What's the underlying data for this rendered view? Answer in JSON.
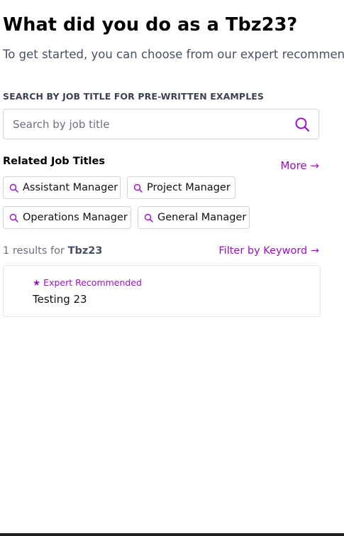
{
  "header": {
    "title": "What did you do as a Tbz23?",
    "subtitle": "To get started, you can choose from our expert recommende"
  },
  "search": {
    "label": "SEARCH BY JOB TITLE FOR PRE-WRITTEN EXAMPLES",
    "placeholder": "Search by job title",
    "value": "",
    "icon": "search-icon"
  },
  "related": {
    "title": "Related Job Titles",
    "more_label": "More →",
    "items": [
      {
        "label": "Assistant Manager",
        "icon": "search-icon"
      },
      {
        "label": "Project Manager",
        "icon": "search-icon"
      },
      {
        "label": "Operations Manager",
        "icon": "search-icon"
      },
      {
        "label": "General Manager",
        "icon": "search-icon"
      }
    ]
  },
  "results": {
    "count_prefix": "1 results for ",
    "query": "Tbz23",
    "filter_label": "Filter by Keyword →",
    "items": [
      {
        "badge": "★ Expert Recommended",
        "title": "Testing 23"
      }
    ]
  },
  "colors": {
    "accent": "#9b10c8",
    "text": "#000000",
    "muted": "#6b7180",
    "border": "#cfd3db"
  }
}
